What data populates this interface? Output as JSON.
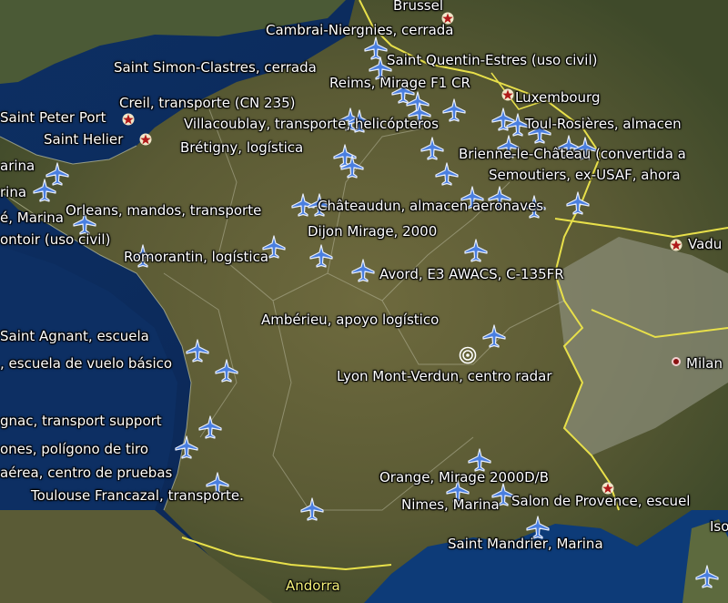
{
  "map": {
    "name": "France military airbases"
  },
  "labels": {
    "brussel": "Brussel",
    "cambrai": "Cambrai-Niergnies, cerrada",
    "stsimon": "Saint Simon-Clastres, cerrada",
    "stquentin": "Saint Quentin-Estres (uso civil)",
    "reims": "Reims, Mirage F1 CR",
    "creil": "Creil, transporte (CN 235)",
    "luxembourg": "Luxembourg",
    "stpeter": "Saint Peter Port",
    "villacoublay": "Villacoublay, transporte, helicópteros",
    "toul": "Toul-Rosières, almacen",
    "sthelier": "Saint Helier",
    "bretigny": "Brétigny, logística",
    "brienne": "Brienne-le-Château (convertida a",
    "marina1": "arina",
    "semoutiers": "Semoutiers, ex-USAF, ahora",
    "marina2": "rina",
    "chateaudun": "Châteaudun, almacen aeronaves",
    "orleans": "Orleans, mandos, transporte",
    "emarina": "é, Marina",
    "dijon": "Dijon Mirage, 2000",
    "ontoir": "ontoir (uso civil)",
    "vaduz": "Vadu",
    "romorantin": "Romorantin, logística",
    "avord": "Avord, E3 AWACS, C-135FR",
    "amberieu": "Ambérieu, apoyo logístico",
    "stagnant": "Saint Agnant, escuela",
    "vuelo": ", escuela de vuelo básico",
    "milan": "Milan",
    "lyon": "Lyon Mont-Verdun, centro radar",
    "cognac": "gnac, transport support",
    "ones": "ones, polígono de tiro",
    "aerea": "aérea, centro de pruebas",
    "orange": "Orange, Mirage 2000D/B",
    "toulouse": "Toulouse Francazal, transporte.",
    "nimes": "Nimes, Marina",
    "salon": "Salon de Provence, escuel",
    "iso": "Iso",
    "mandrier": "Saint Mandrier, Marina",
    "andorra": "Andorra"
  },
  "colors": {
    "plane": "#4a7fe0",
    "star": "#b01a1a",
    "border": "#e8e04a"
  }
}
